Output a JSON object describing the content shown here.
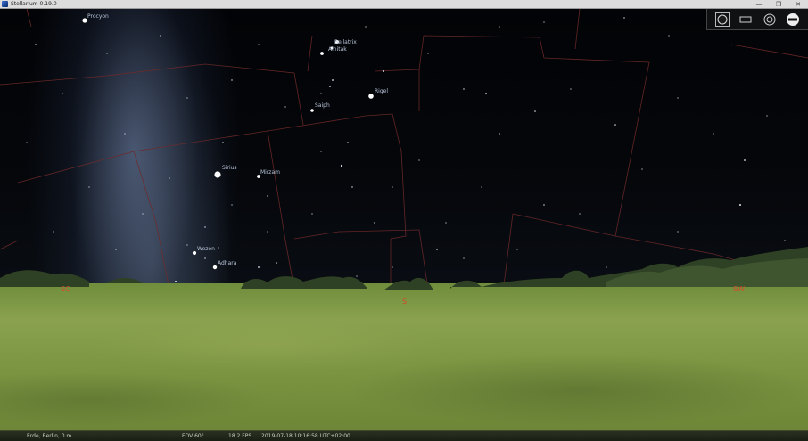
{
  "window": {
    "title": "Stellarium 0.19.0",
    "buttons": [
      "—",
      "❐",
      "✕"
    ]
  },
  "stars": [
    {
      "name": "Procyon"
    },
    {
      "name": "Bellatrix"
    },
    {
      "name": "Alnitak"
    },
    {
      "name": "Rigel"
    },
    {
      "name": "Saiph"
    },
    {
      "name": "Sirius"
    },
    {
      "name": "Mirzam"
    },
    {
      "name": "Wezen"
    },
    {
      "name": "Adhara"
    }
  ],
  "cardinals": {
    "southeast": "SO",
    "south": "S",
    "southwest": "SW"
  },
  "toolbar": {
    "icons": [
      "circle-filled-icon",
      "rectangle-icon",
      "target-icon",
      "minus-circle-icon"
    ]
  },
  "status": {
    "location": "Erde, Berlin, 0 m",
    "fov": "FOV 60°",
    "fps": "18.2 FPS",
    "datetime": "2019-07-18 10:16:58 UTC+02:00"
  },
  "colors": {
    "constellation_lines": "#6e2a2a",
    "cardinal": "#d24a2a",
    "label": "#b7c4d8"
  }
}
